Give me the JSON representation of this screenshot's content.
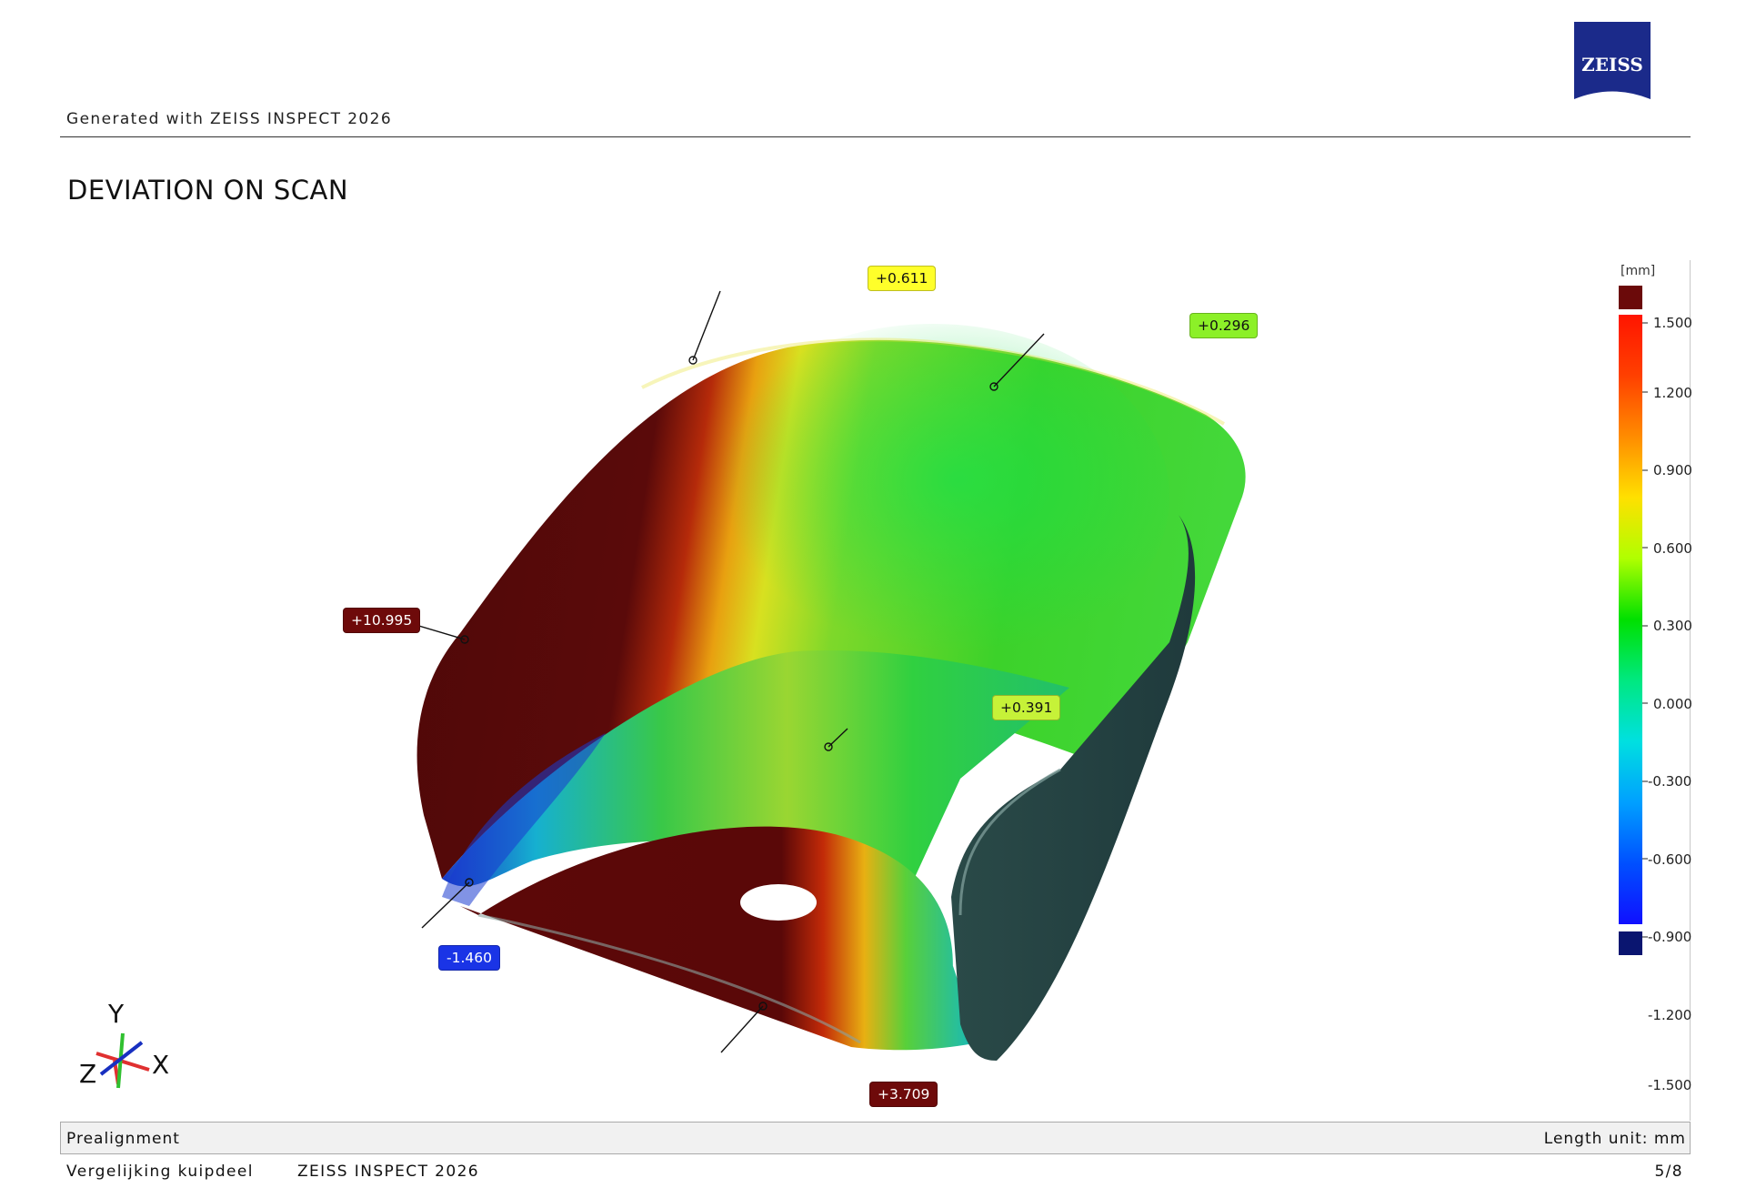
{
  "header": {
    "generated_text": "Generated with ZEISS INSPECT 2026",
    "logo_text": "ZEISS"
  },
  "page_title": "DEVIATION ON SCAN",
  "legend": {
    "unit": "[mm]",
    "ticks": [
      "1.500",
      "1.200",
      "0.900",
      "0.600",
      "0.300",
      "0.000",
      "-0.300",
      "-0.600",
      "-0.900",
      "-1.200",
      "-1.500"
    ],
    "overflow_color": "#6b0a0a",
    "underflow_color": "#0a1570"
  },
  "labels": {
    "l1": {
      "text": "+0.611",
      "color": "#ffff2a"
    },
    "l2": {
      "text": "+0.296",
      "color": "#8cf028"
    },
    "l3": {
      "text": "+10.995",
      "color": "#6e0a0a"
    },
    "l4": {
      "text": "+0.391",
      "color": "#c6f238"
    },
    "l5": {
      "text": "-1.460",
      "color": "#1a34e6"
    },
    "l6": {
      "text": "+3.709",
      "color": "#6e0a0a"
    }
  },
  "axes": {
    "x": "X",
    "y": "Y",
    "z": "Z"
  },
  "statusbar": {
    "left": "Prealignment",
    "right": "Length unit: mm"
  },
  "footer": {
    "project": "Vergelijking kuipdeel",
    "software": "ZEISS INSPECT 2026",
    "page": "5/8"
  }
}
